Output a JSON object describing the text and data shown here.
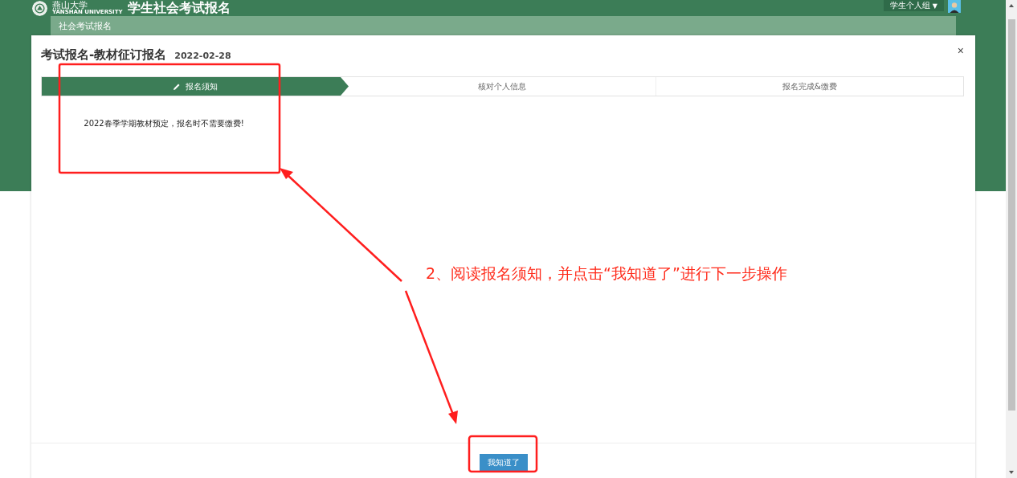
{
  "header": {
    "logo_name": "燕山大学",
    "logo_subtitle": "YANSHAN UNIVERSITY",
    "title": "学生社会考试报名",
    "user_menu": {
      "label": "学生个人组",
      "caret": "▼"
    }
  },
  "breadcrumb": "社会考试报名",
  "dialog": {
    "title": "考试报名-教材征订报名",
    "date": "2022-02-28",
    "close": "×",
    "steps": [
      {
        "label": "报名须知",
        "selected": true
      },
      {
        "label": "核对个人信息",
        "selected": false
      },
      {
        "label": "报名完成&缴费",
        "selected": false
      }
    ],
    "notice": "2022春季学期教材预定，报名时不需要缴费!",
    "confirm_button": "我知道了"
  },
  "annotation": {
    "text": "2、阅读报名须知，并点击“我知道了”进行下一步操作"
  }
}
